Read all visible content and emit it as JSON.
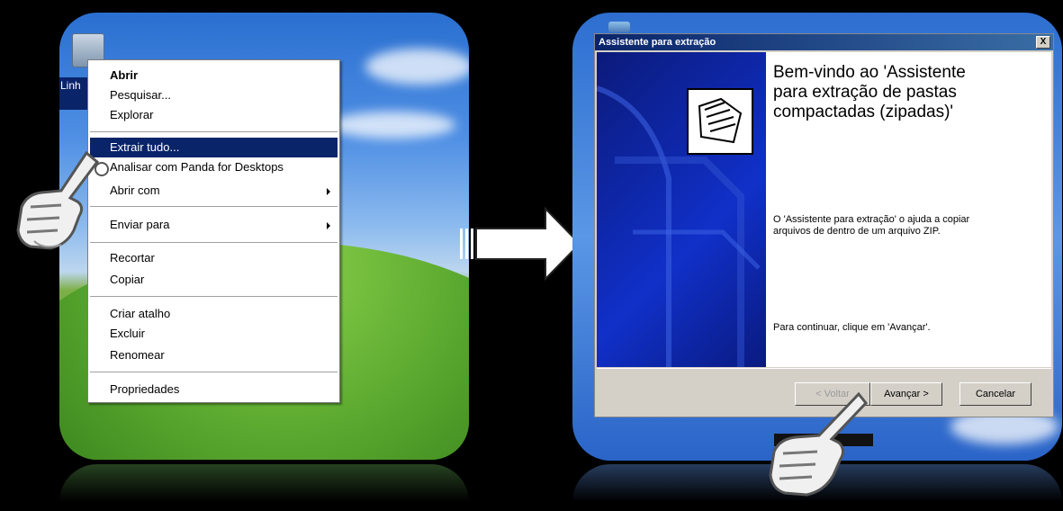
{
  "desktop_icon_label": "Linh",
  "context_menu": {
    "items": [
      {
        "label": "Abrir"
      },
      {
        "label": "Pesquisar..."
      },
      {
        "label": "Explorar"
      },
      {
        "label": "Extrair tudo..."
      },
      {
        "label": "Analisar com Panda for Desktops"
      },
      {
        "label": "Abrir com"
      },
      {
        "label": "Enviar para"
      },
      {
        "label": "Recortar"
      },
      {
        "label": "Copiar"
      },
      {
        "label": "Criar atalho"
      },
      {
        "label": "Excluir"
      },
      {
        "label": "Renomear"
      },
      {
        "label": "Propriedades"
      }
    ]
  },
  "dialog": {
    "title": "Assistente para extração",
    "close_label": "X",
    "heading": "Bem-vindo ao 'Assistente para extração de pastas compactadas (zipadas)'",
    "description": "O 'Assistente para extração' o ajuda a copiar arquivos de dentro de um arquivo ZIP.",
    "continue_text": "Para continuar, clique em 'Avançar'.",
    "back_label": "< Voltar",
    "next_label": "Avançar >",
    "cancel_label": "Cancelar"
  },
  "colors": {
    "selection": "#0a246a",
    "titlebar": "#0a246a"
  }
}
